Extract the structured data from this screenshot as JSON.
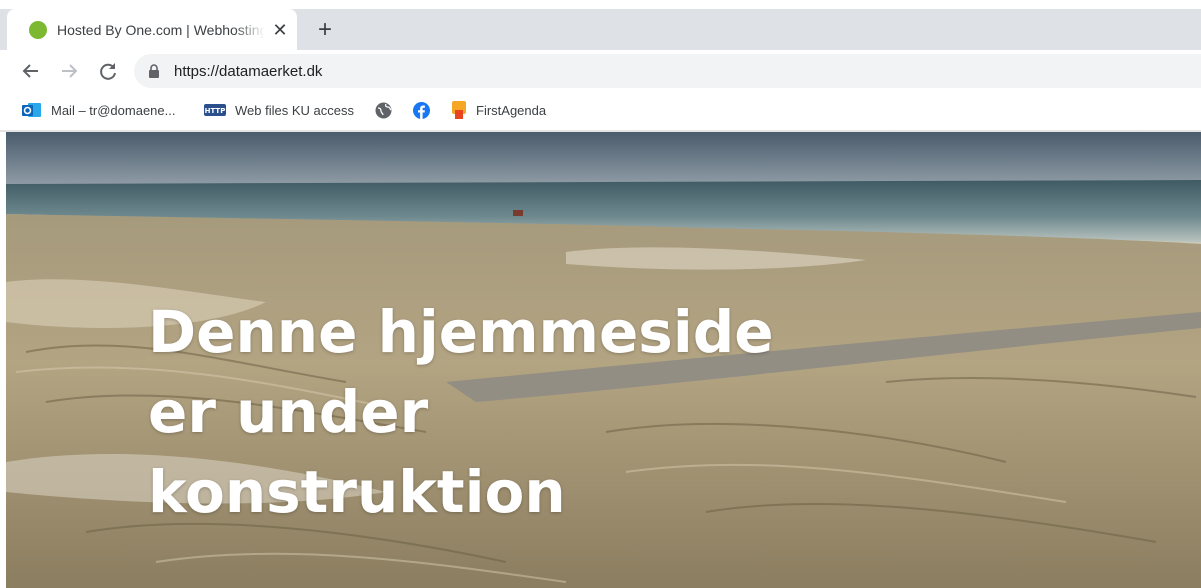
{
  "browser": {
    "tab": {
      "title": "Hosted By One.com | Webhosting",
      "favicon": "green-circle-icon",
      "close_icon": "close-icon"
    },
    "new_tab_icon": "plus-icon",
    "nav": {
      "back_icon": "arrow-left-icon",
      "forward_icon": "arrow-right-icon",
      "reload_icon": "reload-icon"
    },
    "address_bar": {
      "lock_icon": "lock-icon",
      "url": "https://datamaerket.dk"
    },
    "bookmarks": [
      {
        "label": "Mail – tr@domaene...",
        "icon": "outlook-icon"
      },
      {
        "label": "Web files KU access",
        "icon": "http-icon"
      },
      {
        "label": "",
        "icon": "globe-icon"
      },
      {
        "label": "",
        "icon": "facebook-icon"
      },
      {
        "label": "FirstAgenda",
        "icon": "firstagenda-icon"
      }
    ]
  },
  "page": {
    "heading_line1": "Denne hjemmeside",
    "heading_line2": "er under",
    "heading_line3": "konstruktion",
    "background": "beach-dunes-photo"
  },
  "colors": {
    "tab_strip": "#dee1e6",
    "omnibox": "#f1f3f4",
    "favicon": "#7cb832",
    "facebook": "#1877f2",
    "firstagenda": "#f5a623",
    "heading_text": "#ffffff"
  }
}
